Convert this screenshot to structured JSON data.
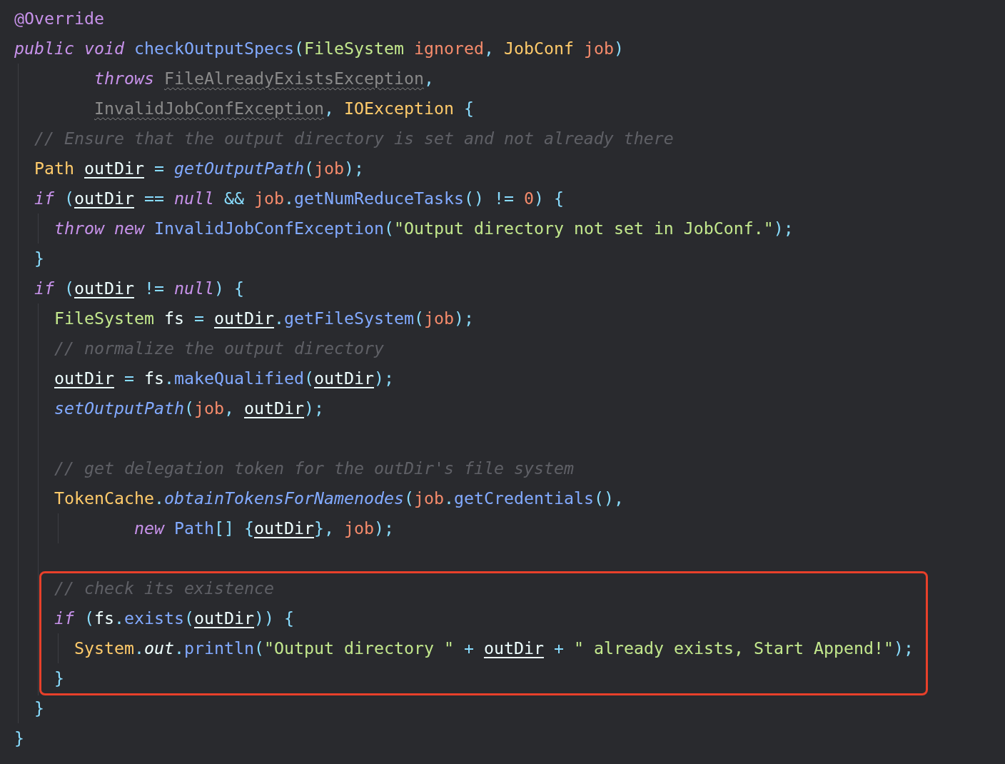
{
  "editor": {
    "lines": [
      {
        "kind": "line",
        "tokens": [
          {
            "text": "@Override",
            "kind": "annotation"
          }
        ]
      },
      {
        "kind": "line",
        "tokens": [
          {
            "text": "public void ",
            "kind": "keyword"
          },
          {
            "text": "checkOutputSpecs",
            "kind": "method"
          },
          {
            "text": "(",
            "kind": "punct"
          },
          {
            "text": "FileSystem",
            "kind": "interface"
          },
          {
            "text": " ignored",
            "kind": "param"
          },
          {
            "text": ", ",
            "kind": "punct"
          },
          {
            "text": "JobConf",
            "kind": "class"
          },
          {
            "text": " job",
            "kind": "param"
          },
          {
            "text": ")",
            "kind": "punct"
          }
        ],
        "children": [
          {
            "kind": "continuation",
            "tokens": [
              {
                "text": "throws ",
                "kind": "keyword"
              },
              {
                "text": "FileAlreadyExistsException",
                "kind": "deprecated"
              },
              {
                "text": ",",
                "kind": "punct"
              }
            ]
          },
          {
            "kind": "continuation",
            "tokens": [
              {
                "text": "InvalidJobConfException",
                "kind": "deprecated"
              },
              {
                "text": ", ",
                "kind": "punct"
              },
              {
                "text": "IOException",
                "kind": "class"
              },
              {
                "text": " {",
                "kind": "punct"
              }
            ]
          },
          {
            "kind": "line",
            "tokens": [
              {
                "text": "// Ensure that the output directory is set and not already there",
                "kind": "comment"
              }
            ]
          },
          {
            "kind": "line",
            "tokens": [
              {
                "text": "Path ",
                "kind": "class"
              },
              {
                "text": "outDir",
                "kind": "reassigned"
              },
              {
                "text": " = ",
                "kind": "punct"
              },
              {
                "text": "getOutputPath",
                "kind": "method-static"
              },
              {
                "text": "(",
                "kind": "punct"
              },
              {
                "text": "job",
                "kind": "param"
              },
              {
                "text": ");",
                "kind": "punct"
              }
            ]
          },
          {
            "kind": "line",
            "tokens": [
              {
                "text": "if ",
                "kind": "keyword"
              },
              {
                "text": "(",
                "kind": "punct"
              },
              {
                "text": "outDir",
                "kind": "reassigned"
              },
              {
                "text": " == ",
                "kind": "punct"
              },
              {
                "text": "null",
                "kind": "keyword"
              },
              {
                "text": " && ",
                "kind": "punct"
              },
              {
                "text": "job",
                "kind": "param"
              },
              {
                "text": ".",
                "kind": "punct"
              },
              {
                "text": "getNumReduceTasks",
                "kind": "method"
              },
              {
                "text": "() != ",
                "kind": "punct"
              },
              {
                "text": "0",
                "kind": "number"
              },
              {
                "text": ") {",
                "kind": "punct"
              }
            ],
            "children": [
              {
                "kind": "line",
                "tokens": [
                  {
                    "text": "throw new ",
                    "kind": "keyword"
                  },
                  {
                    "text": "InvalidJobConfException",
                    "kind": "method"
                  },
                  {
                    "text": "(",
                    "kind": "punct"
                  },
                  {
                    "text": "\"Output directory not set in JobConf.\"",
                    "kind": "string"
                  },
                  {
                    "text": ");",
                    "kind": "punct"
                  }
                ]
              }
            ]
          },
          {
            "kind": "line",
            "tokens": [
              {
                "text": "}",
                "kind": "punct"
              }
            ]
          },
          {
            "kind": "line",
            "tokens": [
              {
                "text": "if ",
                "kind": "keyword"
              },
              {
                "text": "(",
                "kind": "punct"
              },
              {
                "text": "outDir",
                "kind": "reassigned"
              },
              {
                "text": " != ",
                "kind": "punct"
              },
              {
                "text": "null",
                "kind": "keyword"
              },
              {
                "text": ") {",
                "kind": "punct"
              }
            ],
            "children": [
              {
                "kind": "line",
                "tokens": [
                  {
                    "text": "FileSystem",
                    "kind": "interface"
                  },
                  {
                    "text": " fs",
                    "kind": "plain"
                  },
                  {
                    "text": " = ",
                    "kind": "punct"
                  },
                  {
                    "text": "outDir",
                    "kind": "reassigned"
                  },
                  {
                    "text": ".",
                    "kind": "punct"
                  },
                  {
                    "text": "getFileSystem",
                    "kind": "method"
                  },
                  {
                    "text": "(",
                    "kind": "punct"
                  },
                  {
                    "text": "job",
                    "kind": "param"
                  },
                  {
                    "text": ");",
                    "kind": "punct"
                  }
                ]
              },
              {
                "kind": "line",
                "tokens": [
                  {
                    "text": "// normalize the output directory",
                    "kind": "comment"
                  }
                ]
              },
              {
                "kind": "line",
                "tokens": [
                  {
                    "text": "outDir",
                    "kind": "reassigned"
                  },
                  {
                    "text": " = ",
                    "kind": "punct"
                  },
                  {
                    "text": "fs",
                    "kind": "plain"
                  },
                  {
                    "text": ".",
                    "kind": "punct"
                  },
                  {
                    "text": "makeQualified",
                    "kind": "method"
                  },
                  {
                    "text": "(",
                    "kind": "punct"
                  },
                  {
                    "text": "outDir",
                    "kind": "reassigned"
                  },
                  {
                    "text": ");",
                    "kind": "punct"
                  }
                ]
              },
              {
                "kind": "line",
                "tokens": [
                  {
                    "text": "setOutputPath",
                    "kind": "method-static"
                  },
                  {
                    "text": "(",
                    "kind": "punct"
                  },
                  {
                    "text": "job",
                    "kind": "param"
                  },
                  {
                    "text": ", ",
                    "kind": "punct"
                  },
                  {
                    "text": "outDir",
                    "kind": "reassigned"
                  },
                  {
                    "text": ");",
                    "kind": "punct"
                  }
                ]
              },
              {
                "kind": "blank"
              },
              {
                "kind": "line",
                "tokens": [
                  {
                    "text": "// get delegation token for the outDir's file system",
                    "kind": "comment"
                  }
                ]
              },
              {
                "kind": "line",
                "tokens": [
                  {
                    "text": "TokenCache",
                    "kind": "class"
                  },
                  {
                    "text": ".",
                    "kind": "punct"
                  },
                  {
                    "text": "obtainTokensForNamenodes",
                    "kind": "method-static"
                  },
                  {
                    "text": "(",
                    "kind": "punct"
                  },
                  {
                    "text": "job",
                    "kind": "param"
                  },
                  {
                    "text": ".",
                    "kind": "punct"
                  },
                  {
                    "text": "getCredentials",
                    "kind": "method"
                  },
                  {
                    "text": "(),",
                    "kind": "punct"
                  }
                ],
                "children": [
                  {
                    "kind": "continuation",
                    "tokens": [
                      {
                        "text": "new ",
                        "kind": "keyword"
                      },
                      {
                        "text": "Path",
                        "kind": "method"
                      },
                      {
                        "text": "[] {",
                        "kind": "punct"
                      },
                      {
                        "text": "outDir",
                        "kind": "reassigned"
                      },
                      {
                        "text": "}, ",
                        "kind": "punct"
                      },
                      {
                        "text": "job",
                        "kind": "param"
                      },
                      {
                        "text": ");",
                        "kind": "punct"
                      }
                    ]
                  }
                ]
              },
              {
                "kind": "blank"
              },
              {
                "kind": "highlight",
                "children": [
                  {
                    "kind": "line",
                    "tokens": [
                      {
                        "text": "// check its existence",
                        "kind": "comment"
                      }
                    ]
                  },
                  {
                    "kind": "line",
                    "tokens": [
                      {
                        "text": "if ",
                        "kind": "keyword"
                      },
                      {
                        "text": "(",
                        "kind": "punct"
                      },
                      {
                        "text": "fs",
                        "kind": "plain"
                      },
                      {
                        "text": ".",
                        "kind": "punct"
                      },
                      {
                        "text": "exists",
                        "kind": "method"
                      },
                      {
                        "text": "(",
                        "kind": "punct"
                      },
                      {
                        "text": "outDir",
                        "kind": "reassigned"
                      },
                      {
                        "text": ")) {",
                        "kind": "punct"
                      }
                    ],
                    "children": [
                      {
                        "kind": "line",
                        "tokens": [
                          {
                            "text": "System",
                            "kind": "class"
                          },
                          {
                            "text": ".",
                            "kind": "punct"
                          },
                          {
                            "text": "out",
                            "kind": "static-field"
                          },
                          {
                            "text": ".",
                            "kind": "punct"
                          },
                          {
                            "text": "println",
                            "kind": "method"
                          },
                          {
                            "text": "(",
                            "kind": "punct"
                          },
                          {
                            "text": "\"Output directory \"",
                            "kind": "string"
                          },
                          {
                            "text": " + ",
                            "kind": "punct"
                          },
                          {
                            "text": "outDir",
                            "kind": "reassigned"
                          },
                          {
                            "text": " + ",
                            "kind": "punct"
                          },
                          {
                            "text": "\" already exists, Start Append!\"",
                            "kind": "string"
                          },
                          {
                            "text": ");",
                            "kind": "punct"
                          }
                        ]
                      }
                    ]
                  },
                  {
                    "kind": "line",
                    "tokens": [
                      {
                        "text": "}",
                        "kind": "punct"
                      }
                    ]
                  }
                ]
              }
            ]
          },
          {
            "kind": "line",
            "tokens": [
              {
                "text": "}",
                "kind": "punct"
              }
            ]
          }
        ]
      },
      {
        "kind": "line",
        "tokens": [
          {
            "text": "}",
            "kind": "punct"
          }
        ]
      }
    ]
  }
}
